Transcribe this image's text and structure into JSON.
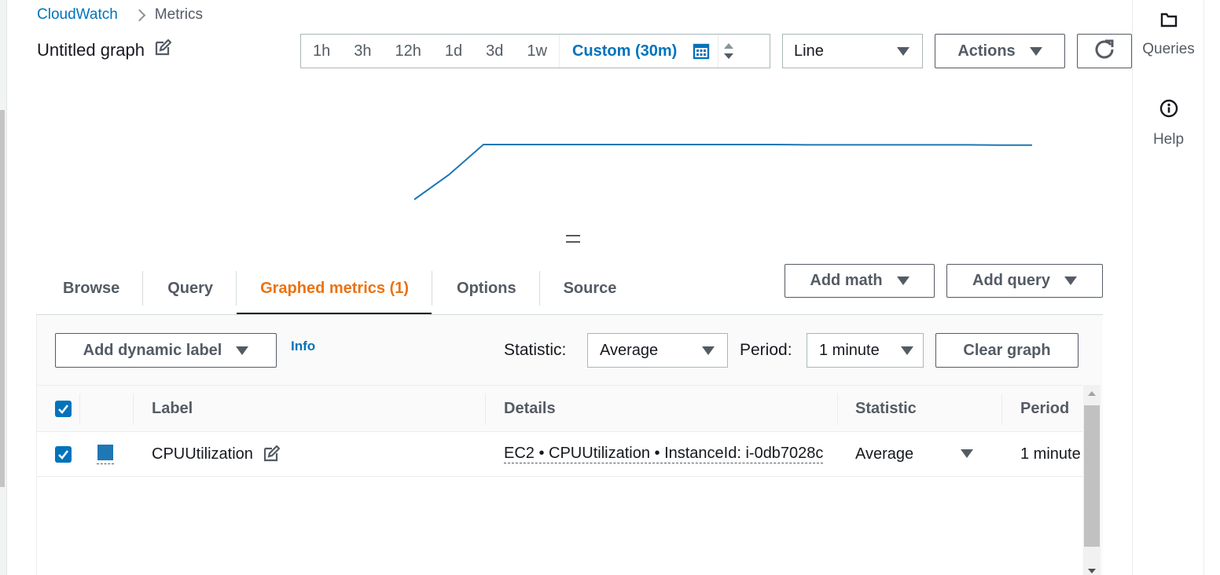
{
  "breadcrumb": {
    "root": "CloudWatch",
    "current": "Metrics"
  },
  "graph": {
    "title": "Untitled graph"
  },
  "time_range": {
    "options": [
      "1h",
      "3h",
      "12h",
      "1d",
      "3d",
      "1w"
    ],
    "custom": "Custom (30m)"
  },
  "toolbar": {
    "chart_type": "Line",
    "actions_label": "Actions"
  },
  "right_rail": {
    "queries": "Queries",
    "help": "Help"
  },
  "chart_data": {
    "type": "line",
    "x": [
      0,
      1,
      2,
      3,
      4,
      5,
      6,
      7,
      8,
      9,
      10,
      11,
      12,
      13,
      14,
      15,
      16,
      17,
      18,
      19
    ],
    "series": [
      {
        "values": [
          0.0,
          0.45,
          1.0,
          1.0,
          1.0,
          1.0,
          1.0,
          1.0,
          1.0,
          1.0,
          1.0,
          1.0,
          0.995,
          0.995,
          0.995,
          0.995,
          0.995,
          0.995,
          0.99,
          0.99
        ]
      }
    ],
    "color": "#1f77b4",
    "grid": false,
    "legend": "none"
  },
  "tabs": [
    {
      "label": "Browse"
    },
    {
      "label": "Query"
    },
    {
      "label": "Graphed metrics (1)",
      "active": true
    },
    {
      "label": "Options"
    },
    {
      "label": "Source"
    }
  ],
  "tab_actions": {
    "add_math": "Add math",
    "add_query": "Add query"
  },
  "metrics_toolbar": {
    "add_dynamic_label": "Add dynamic label",
    "info": "Info",
    "statistic_label": "Statistic:",
    "statistic_value": "Average",
    "period_label": "Period:",
    "period_value": "1 minute",
    "clear_graph": "Clear graph"
  },
  "table": {
    "columns": [
      "Label",
      "Details",
      "Statistic",
      "Period"
    ],
    "rows": [
      {
        "label": "CPUUtilization",
        "details": "EC2 • CPUUtilization • InstanceId: i-0db7028c",
        "statistic": "Average",
        "period": "1 minute",
        "color": "#1f77b4"
      }
    ]
  },
  "colors": {
    "accent": "#0073bb",
    "active_tab": "#ec7211",
    "series": "#1f77b4"
  }
}
